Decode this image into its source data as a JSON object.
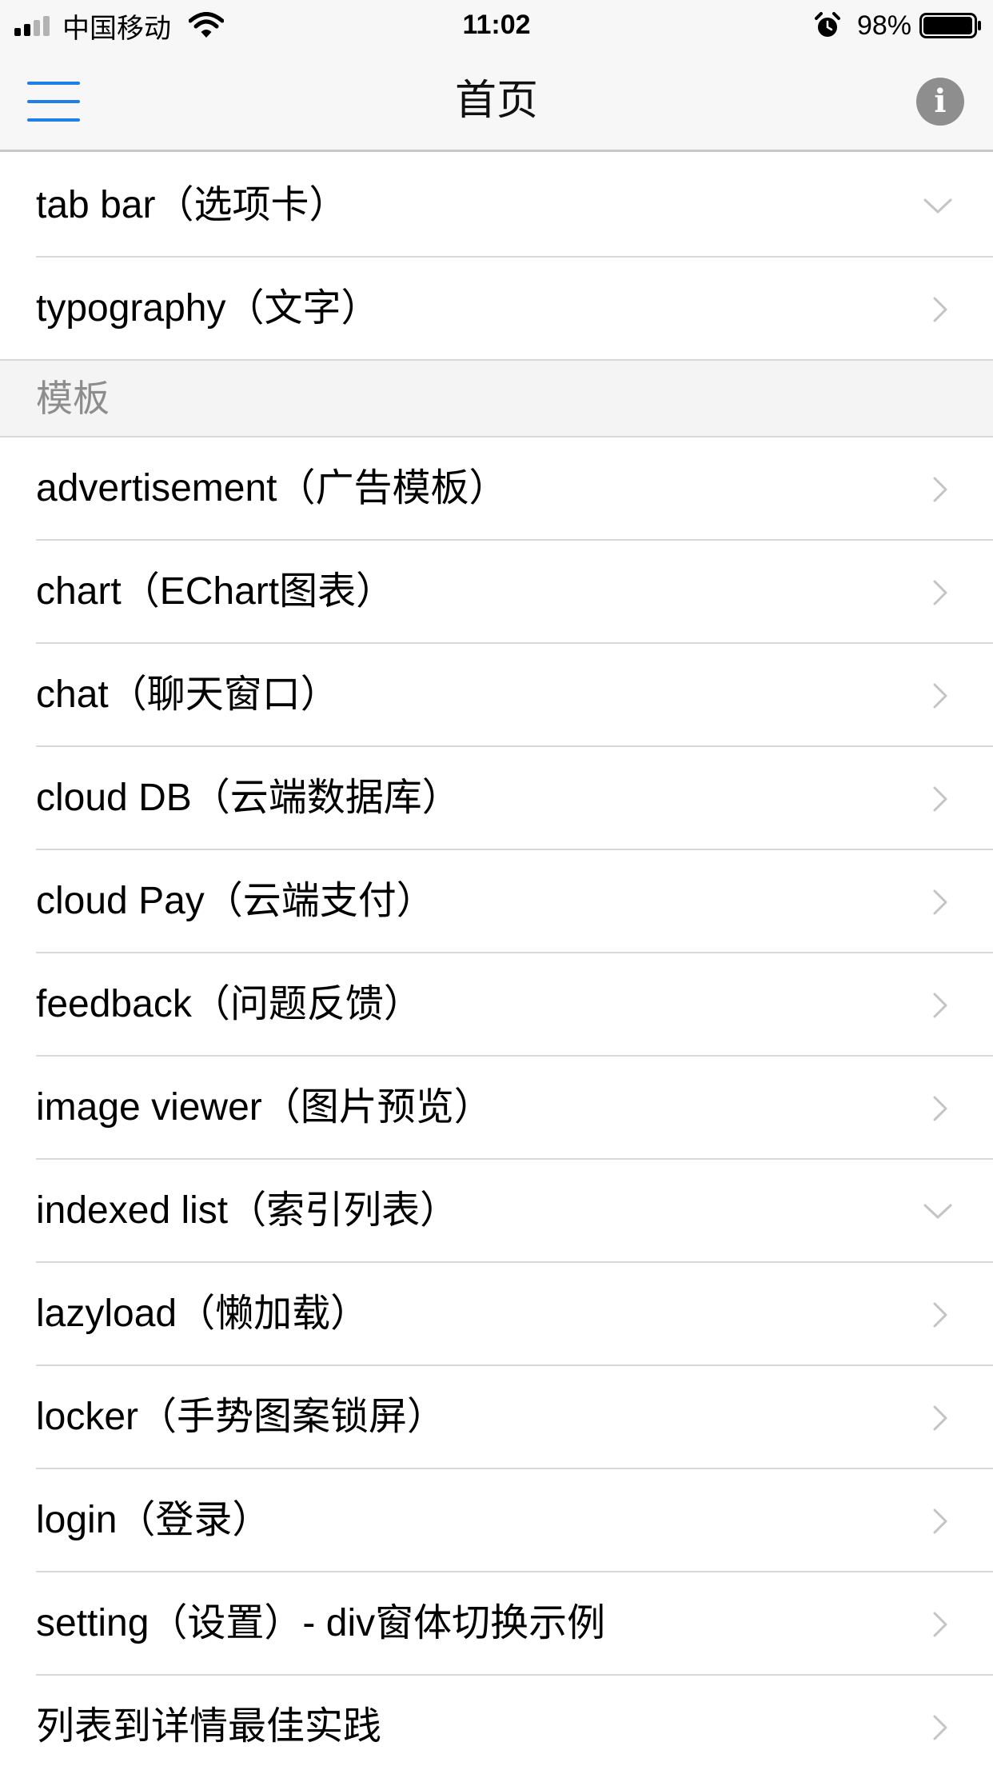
{
  "status_bar": {
    "carrier": "中国移动",
    "time": "11:02",
    "battery": "98%",
    "icons": [
      "signal-icon",
      "wifi-icon",
      "alarm-icon",
      "battery-icon"
    ]
  },
  "header": {
    "title": "首页",
    "menu_icon": "hamburger-menu-icon",
    "info_icon": "info-icon",
    "info_glyph": "i",
    "accent_color": "#1f7fe9"
  },
  "list": {
    "top_items": [
      {
        "label": "tab bar（选项卡）",
        "chevron": "down"
      },
      {
        "label": "typography（文字）",
        "chevron": "right"
      }
    ],
    "section": {
      "title": "模板",
      "items": [
        {
          "label": "advertisement（广告模板）",
          "chevron": "right"
        },
        {
          "label": "chart（EChart图表）",
          "chevron": "right"
        },
        {
          "label": "chat（聊天窗口）",
          "chevron": "right"
        },
        {
          "label": "cloud DB（云端数据库）",
          "chevron": "right"
        },
        {
          "label": "cloud Pay（云端支付）",
          "chevron": "right"
        },
        {
          "label": "feedback（问题反馈）",
          "chevron": "right"
        },
        {
          "label": "image viewer（图片预览）",
          "chevron": "right"
        },
        {
          "label": "indexed list（索引列表）",
          "chevron": "down"
        },
        {
          "label": "lazyload（懒加载）",
          "chevron": "right"
        },
        {
          "label": "locker（手势图案锁屏）",
          "chevron": "right"
        },
        {
          "label": "login（登录）",
          "chevron": "right"
        },
        {
          "label": "setting（设置）- div窗体切换示例",
          "chevron": "right"
        },
        {
          "label": "列表到详情最佳实践",
          "chevron": "right"
        }
      ]
    }
  }
}
